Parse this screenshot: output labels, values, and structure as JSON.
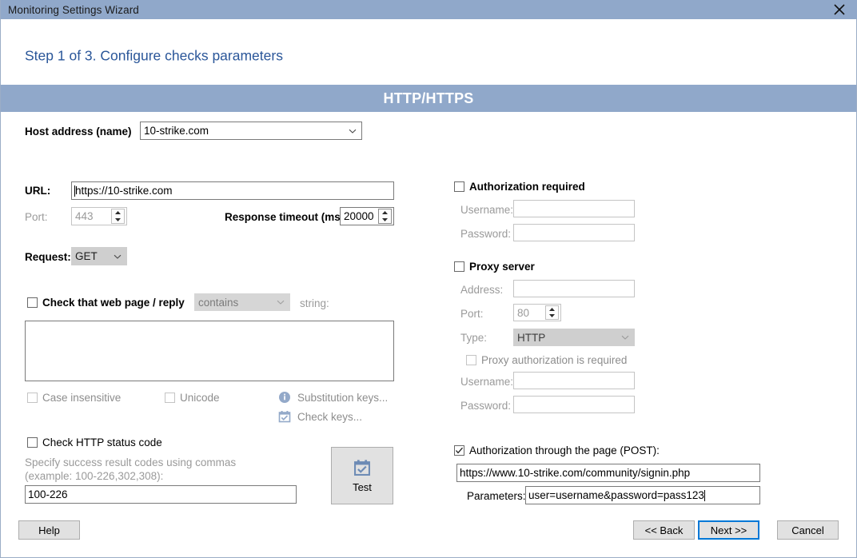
{
  "window": {
    "title": "Monitoring Settings Wizard",
    "close_icon": "close-icon",
    "titlebar_color": "#90a8ca"
  },
  "header": {
    "step_title": "Step 1 of 3. Configure checks parameters",
    "step_title_color": "#2a5699"
  },
  "banner": {
    "title": "HTTP/HTTPS",
    "background": "#90a8ca"
  },
  "host": {
    "label": "Host address (name)",
    "value": "10-strike.com"
  },
  "left": {
    "url_label": "URL:",
    "url_value": "https://10-strike.com",
    "port_label": "Port:",
    "port_value": "443",
    "timeout_label": "Response timeout (ms):",
    "timeout_value": "20000",
    "request_label": "Request:",
    "request_value": "GET",
    "check_page_label": "Check that web page / reply",
    "check_page_condition": "contains",
    "string_label": "string:",
    "check_page_text": "",
    "case_insensitive_label": "Case insensitive",
    "unicode_label": "Unicode",
    "substitution_keys_label": "Substitution keys...",
    "substitution_keys_icon": "info-icon",
    "check_keys_label": "Check keys...",
    "check_keys_icon": "calendar-check-icon",
    "check_status_label": "Check HTTP status code",
    "status_hint_line1": "Specify success result codes using commas",
    "status_hint_line2": "(example: 100-226,302,308):",
    "status_codes_value": "100-226",
    "test_button_label": "Test",
    "test_button_icon": "calendar-check-icon"
  },
  "right": {
    "auth_required_label": "Authorization required",
    "auth_username_label": "Username:",
    "auth_username_value": "",
    "auth_password_label": "Password:",
    "auth_password_value": "",
    "proxy_label": "Proxy server",
    "proxy_address_label": "Address:",
    "proxy_address_value": "",
    "proxy_port_label": "Port:",
    "proxy_port_value": "80",
    "proxy_type_label": "Type:",
    "proxy_type_value": "HTTP",
    "proxy_auth_label": "Proxy authorization is required",
    "proxy_username_label": "Username:",
    "proxy_username_value": "",
    "proxy_password_label": "Password:",
    "proxy_password_value": "",
    "post_auth_label": "Authorization through the page (POST):",
    "post_url_value": "https://www.10-strike.com/community/signin.php",
    "post_parameters_label": "Parameters:",
    "post_parameters_value": "user=username&password=pass123"
  },
  "footer": {
    "help_label": "Help",
    "back_label": "<< Back",
    "next_label": "Next >>",
    "cancel_label": "Cancel",
    "focus_color": "#0078d7"
  }
}
